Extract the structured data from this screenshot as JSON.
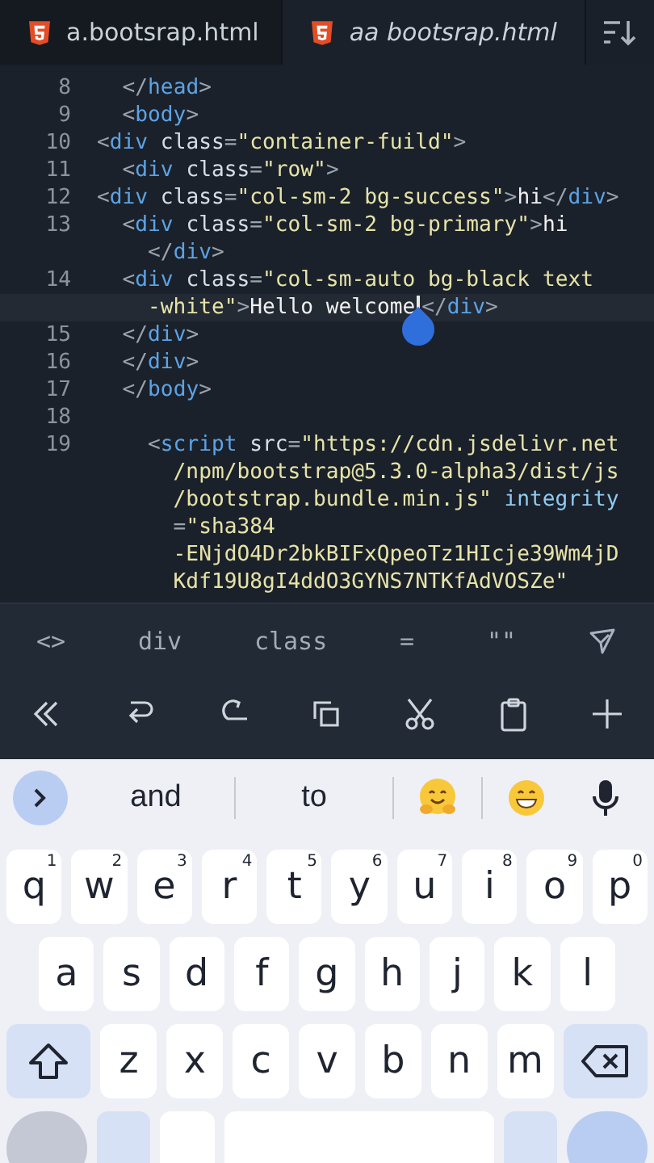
{
  "tabs": [
    {
      "label": "a.bootsrap.html",
      "selected": false,
      "preview": false
    },
    {
      "label": "aa bootsrap.html",
      "selected": true,
      "preview": true
    }
  ],
  "code_rows": [
    {
      "number": "8",
      "tokens": [
        {
          "kind": "p",
          "text": "  </"
        },
        {
          "kind": "t",
          "text": "head"
        },
        {
          "kind": "p",
          "text": ">"
        }
      ]
    },
    {
      "number": "9",
      "tokens": [
        {
          "kind": "p",
          "text": "  <"
        },
        {
          "kind": "t",
          "text": "body"
        },
        {
          "kind": "p",
          "text": ">"
        }
      ]
    },
    {
      "number": "10",
      "tokens": [
        {
          "kind": "p",
          "text": "<"
        },
        {
          "kind": "t",
          "text": "div"
        },
        {
          "kind": "a",
          "text": " class"
        },
        {
          "kind": "p",
          "text": "="
        },
        {
          "kind": "s",
          "text": "\"container-fuild\""
        },
        {
          "kind": "p",
          "text": ">"
        }
      ]
    },
    {
      "number": "11",
      "tokens": [
        {
          "kind": "p",
          "text": "  <"
        },
        {
          "kind": "t",
          "text": "div"
        },
        {
          "kind": "a",
          "text": " class"
        },
        {
          "kind": "p",
          "text": "="
        },
        {
          "kind": "s",
          "text": "\"row\""
        },
        {
          "kind": "p",
          "text": ">"
        }
      ]
    },
    {
      "number": "12",
      "tokens": [
        {
          "kind": "p",
          "text": "<"
        },
        {
          "kind": "t",
          "text": "div"
        },
        {
          "kind": "a",
          "text": " class"
        },
        {
          "kind": "p",
          "text": "="
        },
        {
          "kind": "s",
          "text": "\"col-sm-2 bg-success\""
        },
        {
          "kind": "p",
          "text": ">"
        },
        {
          "kind": "x",
          "text": "hi"
        },
        {
          "kind": "p",
          "text": "</"
        },
        {
          "kind": "t",
          "text": "div"
        },
        {
          "kind": "p",
          "text": ">"
        }
      ]
    },
    {
      "number": "13",
      "tokens": [
        {
          "kind": "p",
          "text": "  <"
        },
        {
          "kind": "t",
          "text": "div"
        },
        {
          "kind": "a",
          "text": " class"
        },
        {
          "kind": "p",
          "text": "="
        },
        {
          "kind": "s",
          "text": "\"col-sm-2 bg-primary\""
        },
        {
          "kind": "p",
          "text": ">"
        },
        {
          "kind": "x",
          "text": "hi"
        }
      ]
    },
    {
      "tokens": [
        {
          "kind": "p",
          "text": "    </"
        },
        {
          "kind": "t",
          "text": "div"
        },
        {
          "kind": "p",
          "text": ">"
        }
      ]
    },
    {
      "number": "14",
      "tokens": [
        {
          "kind": "p",
          "text": "  <"
        },
        {
          "kind": "t",
          "text": "div"
        },
        {
          "kind": "a",
          "text": " class"
        },
        {
          "kind": "p",
          "text": "="
        },
        {
          "kind": "s",
          "text": "\"col-sm-auto bg-black text"
        }
      ]
    },
    {
      "current": true,
      "tokens": [
        {
          "kind": "s",
          "text": "    -white\""
        },
        {
          "kind": "p",
          "text": ">"
        },
        {
          "kind": "x",
          "text": "Hello welcome",
          "caret": true
        },
        {
          "kind": "p",
          "text": "</"
        },
        {
          "kind": "t",
          "text": "div"
        },
        {
          "kind": "p",
          "text": ">"
        }
      ]
    },
    {
      "number": "15",
      "tokens": [
        {
          "kind": "p",
          "text": "  </"
        },
        {
          "kind": "t",
          "text": "div"
        },
        {
          "kind": "p",
          "text": ">"
        }
      ]
    },
    {
      "number": "16",
      "tokens": [
        {
          "kind": "p",
          "text": "  </"
        },
        {
          "kind": "t",
          "text": "div"
        },
        {
          "kind": "p",
          "text": ">"
        }
      ]
    },
    {
      "number": "17",
      "tokens": [
        {
          "kind": "p",
          "text": "  </"
        },
        {
          "kind": "t",
          "text": "body"
        },
        {
          "kind": "p",
          "text": ">"
        }
      ]
    },
    {
      "number": "18"
    },
    {
      "number": "19",
      "tokens": [
        {
          "kind": "p",
          "text": "    <"
        },
        {
          "kind": "t",
          "text": "script"
        },
        {
          "kind": "a",
          "text": " src"
        },
        {
          "kind": "p",
          "text": "="
        },
        {
          "kind": "s",
          "text": "\"https://cdn.jsdelivr.net"
        }
      ]
    },
    {
      "tokens": [
        {
          "kind": "s",
          "text": "      /npm/bootstrap@5.3.0-alpha3/dist/js"
        }
      ]
    },
    {
      "tokens": [
        {
          "kind": "s",
          "text": "      /bootstrap.bundle.min.js\""
        },
        {
          "kind": "k",
          "text": " integrity"
        }
      ]
    },
    {
      "tokens": [
        {
          "kind": "p",
          "text": "      ="
        },
        {
          "kind": "s",
          "text": "\"sha384"
        }
      ]
    },
    {
      "tokens": [
        {
          "kind": "s",
          "text": "      -ENjdO4Dr2bkBIFxQpeoTz1HIcje39Wm4jD"
        }
      ]
    },
    {
      "tokens": [
        {
          "kind": "s",
          "text": "      Kdf19U8gI4ddO3GYNS7NTKfAdVOSZe\""
        }
      ]
    }
  ],
  "snippets": [
    "<>",
    "div",
    "class",
    "=",
    "\"\""
  ],
  "suggestions": [
    "and",
    "to"
  ],
  "key_rows": [
    [
      {
        "label": "q",
        "hint": "1"
      },
      {
        "label": "w",
        "hint": "2"
      },
      {
        "label": "e",
        "hint": "3"
      },
      {
        "label": "r",
        "hint": "4"
      },
      {
        "label": "t",
        "hint": "5"
      },
      {
        "label": "y",
        "hint": "6"
      },
      {
        "label": "u",
        "hint": "7"
      },
      {
        "label": "i",
        "hint": "8"
      },
      {
        "label": "o",
        "hint": "9"
      },
      {
        "label": "p",
        "hint": "0"
      }
    ],
    [
      {
        "label": "a"
      },
      {
        "label": "s"
      },
      {
        "label": "d"
      },
      {
        "label": "f"
      },
      {
        "label": "g"
      },
      {
        "label": "h"
      },
      {
        "label": "j"
      },
      {
        "label": "k"
      },
      {
        "label": "l"
      }
    ],
    [
      {
        "kind": "shift"
      },
      {
        "label": "z"
      },
      {
        "label": "x"
      },
      {
        "label": "c"
      },
      {
        "label": "v"
      },
      {
        "label": "b"
      },
      {
        "label": "n"
      },
      {
        "label": "m"
      },
      {
        "kind": "backspace"
      }
    ]
  ]
}
